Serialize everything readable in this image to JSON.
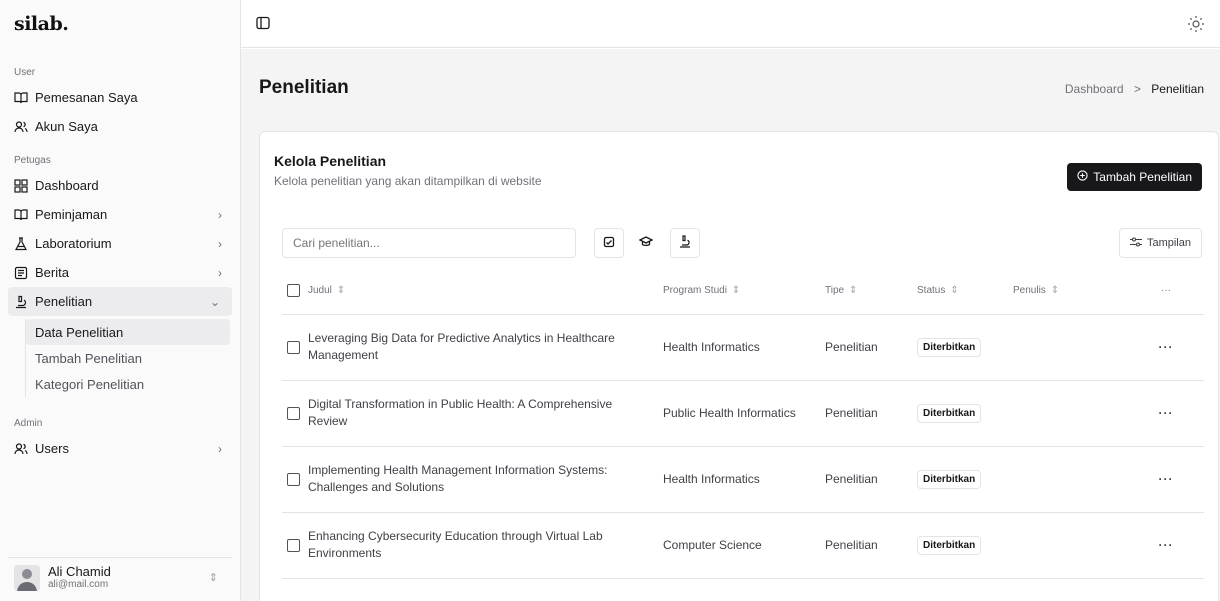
{
  "brand": "silab.",
  "sidebar": {
    "groups": [
      {
        "label": "User",
        "items": [
          {
            "label": "Pemesanan Saya",
            "icon": "book-open-icon"
          },
          {
            "label": "Akun Saya",
            "icon": "users-icon"
          }
        ]
      },
      {
        "label": "Petugas",
        "items": [
          {
            "label": "Dashboard",
            "icon": "grid-icon"
          },
          {
            "label": "Peminjaman",
            "icon": "book-open-icon",
            "chevron": "›"
          },
          {
            "label": "Laboratorium",
            "icon": "flask-icon",
            "chevron": "›"
          },
          {
            "label": "Berita",
            "icon": "newspaper-icon",
            "chevron": "›"
          },
          {
            "label": "Penelitian",
            "icon": "microscope-icon",
            "chevron": "⌄"
          }
        ]
      },
      {
        "label": "Admin",
        "items": [
          {
            "label": "Users",
            "icon": "users-icon",
            "chevron": "›"
          }
        ]
      }
    ],
    "penelitian_sub": [
      "Data Penelitian",
      "Tambah Penelitian",
      "Kategori Penelitian"
    ],
    "user": {
      "name": "Ali Chamid",
      "email": "ali@mail.com"
    }
  },
  "header": {
    "title": "Penelitian",
    "breadcrumb": [
      "Dashboard",
      ">",
      "Penelitian"
    ]
  },
  "card": {
    "title": "Kelola Penelitian",
    "description": "Kelola penelitian yang akan ditampilkan di website",
    "add_button": "Tambah Penelitian",
    "search_placeholder": "Cari penelitian...",
    "view_button": "Tampilan"
  },
  "table": {
    "columns": [
      "Judul",
      "Program Studi",
      "Tipe",
      "Status",
      "Penulis",
      "···"
    ],
    "rows": [
      {
        "title": "Leveraging Big Data for Predictive Analytics in Healthcare Management",
        "program": "Health Informatics",
        "type": "Penelitian",
        "status": "Diterbitkan",
        "writer": "",
        "action": "···"
      },
      {
        "title": "Digital Transformation in Public Health: A Comprehensive Review",
        "program": "Public Health Informatics",
        "type": "Penelitian",
        "status": "Diterbitkan",
        "writer": "",
        "action": "···"
      },
      {
        "title": "Implementing Health Management Information Systems: Challenges and Solutions",
        "program": "Health Informatics",
        "type": "Penelitian",
        "status": "Diterbitkan",
        "writer": "",
        "action": "···"
      },
      {
        "title": "Enhancing Cybersecurity Education through Virtual Lab Environments",
        "program": "Computer Science",
        "type": "Penelitian",
        "status": "Diterbitkan",
        "writer": "",
        "action": "···"
      }
    ]
  }
}
